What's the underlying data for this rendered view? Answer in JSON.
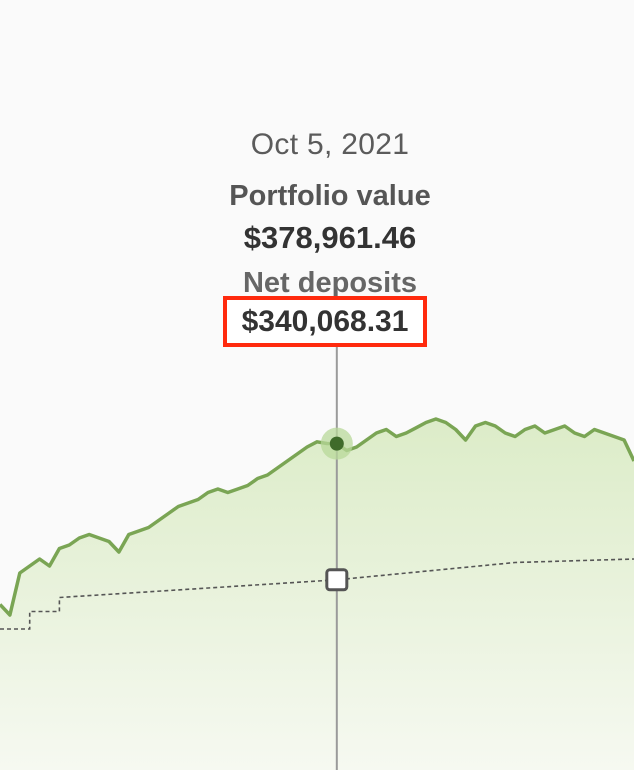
{
  "tooltip": {
    "date": "Oct 5, 2021",
    "portfolio_label": "Portfolio value",
    "portfolio_value": "$378,961.46",
    "deposits_label": "Net deposits",
    "deposits_value": "$340,068.31"
  },
  "colors": {
    "portfolio_line": "#7aa554",
    "portfolio_fill": "#e4f0d4",
    "deposits_line": "#555555",
    "highlight": "#ff2a0e",
    "crosshair": "#9a9a9a"
  },
  "chart_data": {
    "type": "area",
    "title": "",
    "xlabel": "",
    "ylabel": "",
    "grid": false,
    "selected_date": "Oct 5, 2021",
    "series": [
      {
        "name": "Portfolio value",
        "x": [
          0,
          1,
          2,
          3,
          4,
          5,
          6,
          7,
          8,
          9,
          10,
          11,
          12,
          13,
          14,
          15,
          16,
          17,
          18,
          19,
          20,
          21,
          22,
          23,
          24,
          25,
          26,
          27,
          28,
          29,
          30,
          31,
          32,
          33,
          34,
          35,
          36,
          37,
          38,
          39,
          40,
          41,
          42,
          43,
          44,
          45,
          46,
          47,
          48,
          49,
          50,
          51,
          52,
          53,
          54,
          55,
          56,
          57,
          58,
          59,
          60,
          61,
          62,
          63,
          64
        ],
        "values": [
          333000,
          330000,
          342000,
          344000,
          346000,
          344000,
          349000,
          350000,
          352000,
          353000,
          352000,
          351000,
          348000,
          353000,
          354000,
          355000,
          357000,
          359000,
          361000,
          362000,
          363000,
          365000,
          366000,
          365000,
          366000,
          367000,
          369000,
          370000,
          372000,
          374000,
          376000,
          378000,
          379500,
          379000,
          378961.46,
          377000,
          378000,
          380000,
          382000,
          383000,
          381000,
          382000,
          383500,
          385000,
          386000,
          385000,
          383000,
          380000,
          384000,
          385000,
          384000,
          382000,
          381000,
          383000,
          384000,
          382000,
          383000,
          384000,
          382000,
          381000,
          383000,
          382000,
          381000,
          380000,
          374000
        ],
        "selected_index": 34,
        "selected_value": 378961.46
      },
      {
        "name": "Net deposits",
        "x": [
          0,
          2,
          3,
          5,
          6,
          34,
          52,
          64
        ],
        "values": [
          326000,
          326000,
          331000,
          331000,
          335000,
          340068.31,
          345000,
          346000
        ],
        "selected_value": 340068.31
      }
    ]
  }
}
